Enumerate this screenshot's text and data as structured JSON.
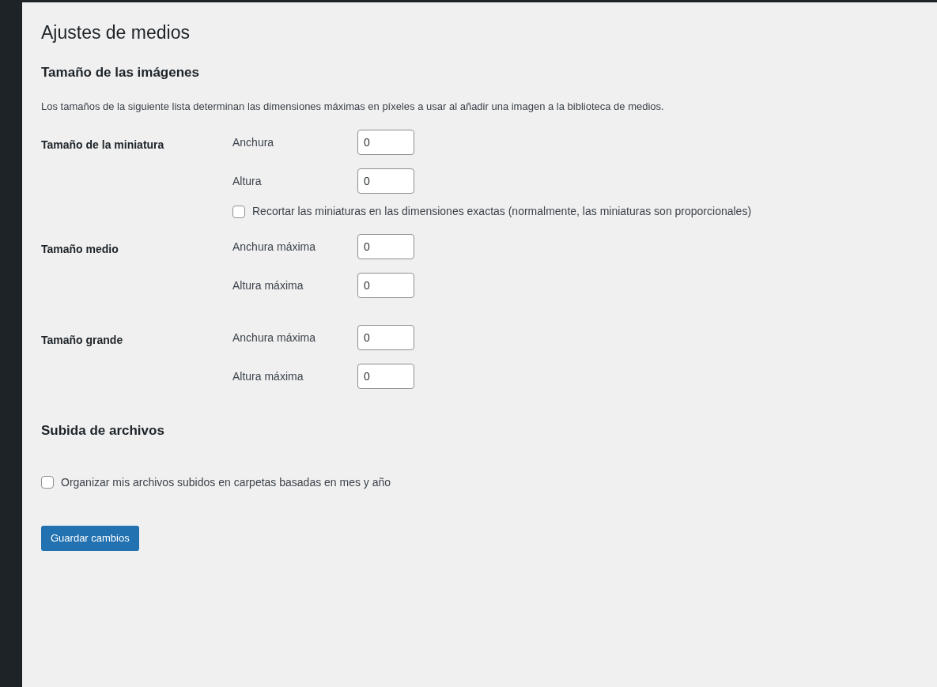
{
  "title": "Ajustes de medios",
  "image_sizes": {
    "heading": "Tamaño de las imágenes",
    "description": "Los tamaños de la siguiente lista determinan las dimensiones máximas en píxeles a usar al añadir una imagen a la biblioteca de medios.",
    "groups": [
      {
        "label": "Tamaño de la miniatura",
        "fields": [
          {
            "label": "Anchura",
            "value": "0"
          },
          {
            "label": "Altura",
            "value": "0"
          }
        ],
        "option": {
          "label": "Recortar las miniaturas en las dimensiones exactas (normalmente, las miniaturas son proporcionales)",
          "checked": false
        }
      },
      {
        "label": "Tamaño medio",
        "fields": [
          {
            "label": "Anchura máxima",
            "value": "0"
          },
          {
            "label": "Altura máxima",
            "value": "0"
          }
        ]
      },
      {
        "label": "Tamaño grande",
        "fields": [
          {
            "label": "Anchura máxima",
            "value": "0"
          },
          {
            "label": "Altura máxima",
            "value": "0"
          }
        ]
      }
    ]
  },
  "uploads": {
    "heading": "Subida de archivos",
    "option": {
      "label": "Organizar mis archivos subidos en carpetas basadas en mes y año",
      "checked": false
    }
  },
  "save_button": "Guardar cambios"
}
